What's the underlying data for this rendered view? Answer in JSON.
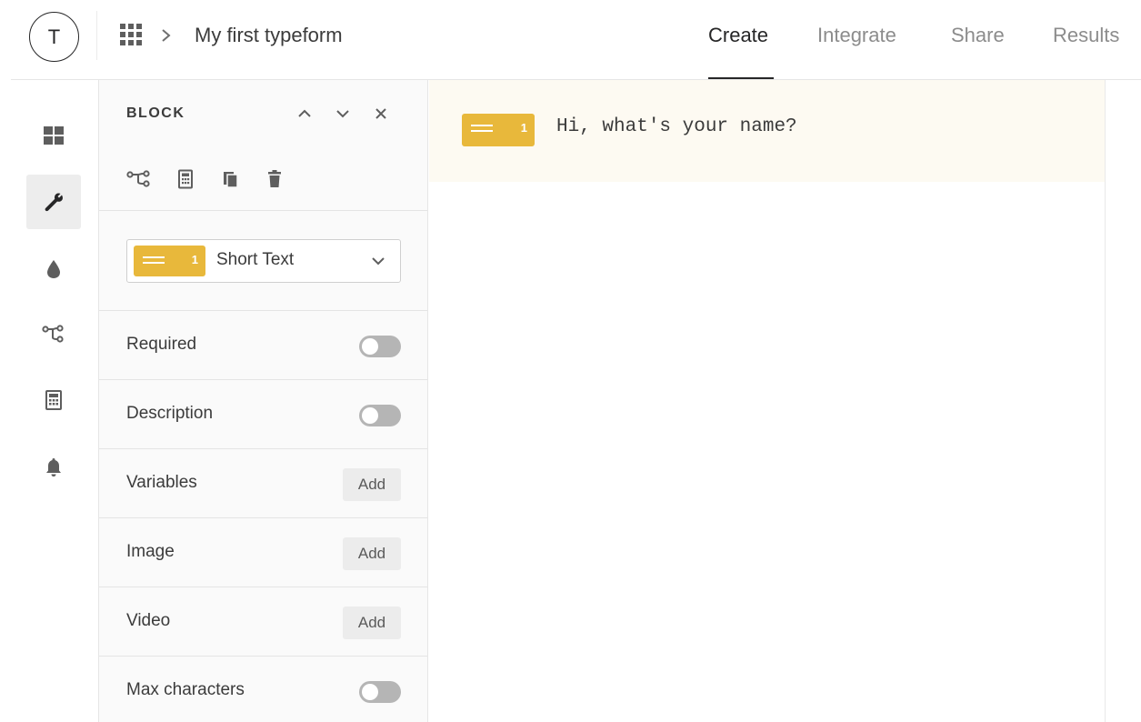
{
  "header": {
    "avatar_letter": "T",
    "form_title": "My first typeform",
    "tabs": [
      {
        "label": "Create",
        "active": true
      },
      {
        "label": "Integrate",
        "active": false
      },
      {
        "label": "Share",
        "active": false
      },
      {
        "label": "Results",
        "active": false
      }
    ]
  },
  "rail": {
    "items": [
      {
        "icon": "grid-icon"
      },
      {
        "icon": "wrench-icon",
        "active": true
      },
      {
        "icon": "drop-icon"
      },
      {
        "icon": "logic-icon"
      },
      {
        "icon": "calculator-icon"
      },
      {
        "icon": "bell-icon"
      }
    ]
  },
  "panel": {
    "title": "BLOCK",
    "type_select": {
      "number": "1",
      "label": "Short Text"
    },
    "settings": [
      {
        "label": "Required",
        "control": "toggle",
        "on": false
      },
      {
        "label": "Description",
        "control": "toggle",
        "on": false
      },
      {
        "label": "Variables",
        "control": "button",
        "button_label": "Add"
      },
      {
        "label": "Image",
        "control": "button",
        "button_label": "Add"
      },
      {
        "label": "Video",
        "control": "button",
        "button_label": "Add"
      },
      {
        "label": "Max characters",
        "control": "toggle",
        "on": false
      }
    ]
  },
  "canvas": {
    "question": {
      "number": "1",
      "text": "Hi, what's your name?"
    }
  },
  "colors": {
    "accent": "#e8b83b",
    "question_bg": "#fdfaf2",
    "panel_bg": "#fafafa"
  }
}
